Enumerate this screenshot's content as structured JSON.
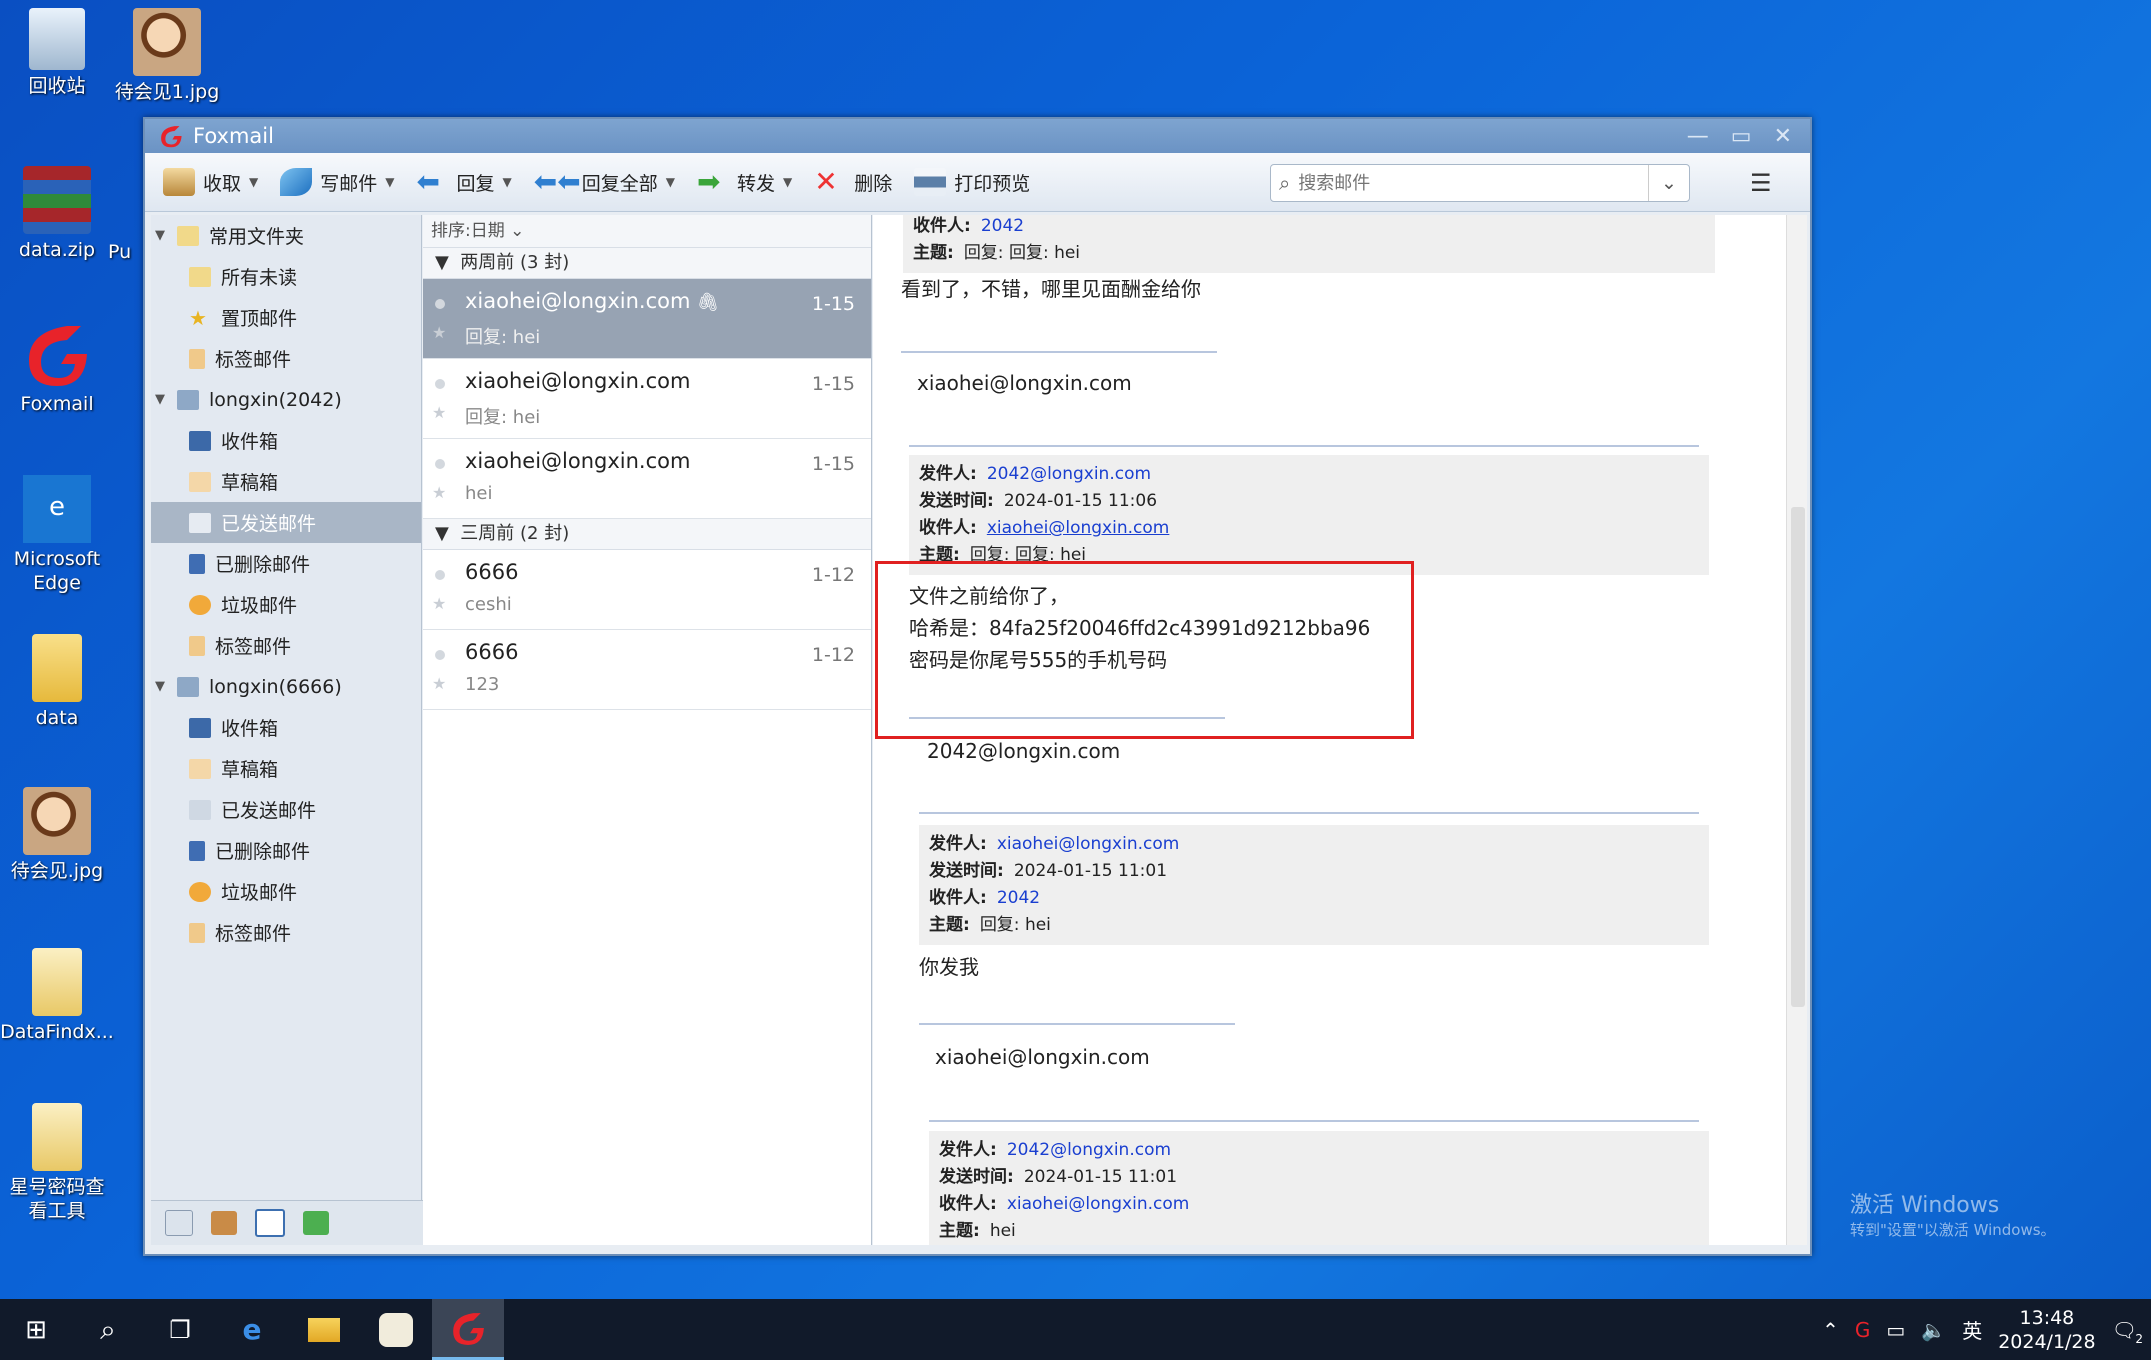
{
  "desktop": {
    "icons": [
      {
        "label": "回收站"
      },
      {
        "label": "待会见1.jpg"
      },
      {
        "label": "data.zip"
      },
      {
        "label": "Pu"
      },
      {
        "label": "Foxmail"
      },
      {
        "label": "Microsoft Edge"
      },
      {
        "label": "data"
      },
      {
        "label": "待会见.jpg"
      },
      {
        "label": "DataFindx..."
      },
      {
        "label": "星号密码查看工具"
      }
    ],
    "activation": {
      "title": "激活 Windows",
      "subtitle": "转到\"设置\"以激活 Windows。"
    }
  },
  "window": {
    "title": "Foxmail",
    "toolbar": {
      "receive": "收取",
      "compose": "写邮件",
      "reply": "回复",
      "reply_all": "回复全部",
      "forward": "转发",
      "delete": "删除",
      "print_preview": "打印预览"
    },
    "search": {
      "placeholder": "搜索邮件"
    },
    "folders": {
      "common": "常用文件夹",
      "all_unread": "所有未读",
      "pinned": "置顶邮件",
      "tagged": "标签邮件",
      "account1": "longxin(2042)",
      "account2": "longxin(6666)",
      "inbox": "收件箱",
      "drafts": "草稿箱",
      "sent": "已发送邮件",
      "deleted": "已删除邮件",
      "junk": "垃圾邮件",
      "tags": "标签邮件"
    },
    "list": {
      "sort": "排序:日期",
      "group1": "两周前 (3 封)",
      "group2": "三周前 (2 封)",
      "mails": [
        {
          "from": "xiaohei@longxin.com",
          "subject": "回复: hei",
          "date": "1-15"
        },
        {
          "from": "xiaohei@longxin.com",
          "subject": "回复: hei",
          "date": "1-15"
        },
        {
          "from": "xiaohei@longxin.com",
          "subject": "hei",
          "date": "1-15"
        },
        {
          "from": "6666",
          "subject": "ceshi",
          "date": "1-12"
        },
        {
          "from": "6666",
          "subject": "123",
          "date": "1-12"
        }
      ]
    },
    "reading": {
      "labels": {
        "from": "发件人:",
        "time": "发送时间:",
        "to": "收件人:",
        "subject": "主题:"
      },
      "top": {
        "to": "2042",
        "subject": "回复: 回复: hei"
      },
      "body1": "看到了，不错，哪里见面酬金给你",
      "sig1": "xiaohei@longxin.com",
      "q1": {
        "from": "2042@longxin.com",
        "time": "2024-01-15 11:06",
        "to": "xiaohei@longxin.com",
        "subject": "回复: 回复: hei"
      },
      "body2_l1": "文件之前给你了，",
      "body2_l2": "哈希是：84fa25f20046ffd2c43991d9212bba96",
      "body2_l3": "密码是你尾号555的手机号码",
      "sig2": "2042@longxin.com",
      "q2": {
        "from": "xiaohei@longxin.com",
        "time": "2024-01-15 11:01",
        "to": "2042",
        "subject": "回复: hei"
      },
      "body3": "你发我",
      "sig3": "xiaohei@longxin.com",
      "q3": {
        "from": "2042@longxin.com",
        "time": "2024-01-15 11:01",
        "to": "xiaohei@longxin.com",
        "subject": "hei"
      }
    }
  },
  "taskbar": {
    "ime": "英",
    "time": "13:48",
    "date": "2024/1/28",
    "notification_count": "2"
  }
}
